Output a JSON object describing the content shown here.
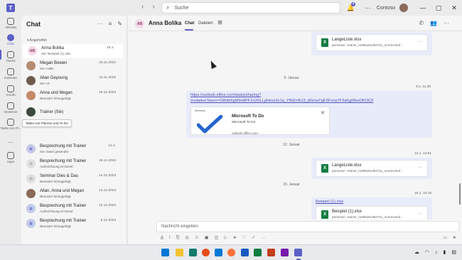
{
  "titlebar": {
    "search_placeholder": "Suche",
    "notification_count": "4",
    "org_name": "Contoso",
    "window_controls": [
      "—",
      "▢",
      "✕"
    ]
  },
  "rail": {
    "items": [
      {
        "label": "Aktivität",
        "icon": "bell-icon"
      },
      {
        "label": "Chat",
        "icon": "chat-icon"
      },
      {
        "label": "Teams",
        "icon": "teams-icon"
      },
      {
        "label": "Kalender",
        "icon": "calendar-icon"
      },
      {
        "label": "Anrufe",
        "icon": "phone-icon"
      },
      {
        "label": "OneDrive",
        "icon": "cloud-icon"
      },
      {
        "label": "Tasks von Pl...",
        "icon": "tasks-icon"
      },
      {
        "label": "...",
        "icon": "more-icon"
      },
      {
        "label": "Apps",
        "icon": "apps-icon"
      }
    ]
  },
  "chatlist": {
    "title": "Chat",
    "pinned_label": "Angeheftet",
    "tooltip": "Tasks von Planner und To Do",
    "chats": [
      {
        "name": "Anna Bolika",
        "sub": "Sie: Beispiel (1).xlsx",
        "date": "15.1.",
        "initials": "AB",
        "color": "#f4d9e6",
        "fg": "#8a3a60",
        "italic": false
      },
      {
        "name": "Megan Bowen",
        "sub": "Sie: Hallo",
        "date": "15.11.2022",
        "initials": "",
        "color": "#b58b6f",
        "fg": "#fff",
        "italic": false
      },
      {
        "name": "Allan Deyoung",
        "sub": "Sie: Hi",
        "date": "15.11.2022",
        "initials": "",
        "color": "#6e5a4e",
        "fg": "#fff",
        "italic": false
      },
      {
        "name": "Anna und Megan",
        "sub": "Benutzer hinzugefügt.",
        "date": "18.12.2023",
        "initials": "",
        "color": "#c4896a",
        "fg": "#fff",
        "italic": true
      },
      {
        "name": "Trainer (Sie)",
        "sub": "",
        "date": "",
        "initials": "",
        "color": "#3d4a3d",
        "fg": "#fff",
        "italic": false
      },
      {
        "name": "Besprechung mit Trainer",
        "sub": "Sie: Datei gesendet",
        "date": "12.1.",
        "initials": "▦",
        "color": "#c5cae9",
        "fg": "#5b5fc7",
        "italic": false
      },
      {
        "name": "Besprechung mit Trainer",
        "sub": "Aufzeichnung ist bereit",
        "date": "18.12.2023",
        "initials": "◷",
        "color": "#e0e0e0",
        "fg": "#616161",
        "italic": true
      },
      {
        "name": "Seminar Dies & Das",
        "sub": "Benutzer hinzugefügt.",
        "date": "14.12.2023",
        "initials": "◷",
        "color": "#e0e0e0",
        "fg": "#616161",
        "italic": true
      },
      {
        "name": "Allan, Anna und Megan",
        "sub": "Benutzer hinzugefügt.",
        "date": "14.12.2023",
        "initials": "",
        "color": "#8a6a5a",
        "fg": "#fff",
        "italic": true
      },
      {
        "name": "Besprechung mit Trainer",
        "sub": "Aufzeichnung ist bereit",
        "date": "12.12.2023",
        "initials": "▦",
        "color": "#c5cae9",
        "fg": "#5b5fc7",
        "italic": true
      },
      {
        "name": "Besprechung mit Trainer",
        "sub": "Benutzer hinzugefügt.",
        "date": "6.12.2023",
        "initials": "▦",
        "color": "#c5cae9",
        "fg": "#5b5fc7",
        "italic": true
      },
      {
        "name": "Besprechung mit Trainer",
        "sub": "Benutzer hinzugefügt.",
        "date": "6.12.2023",
        "initials": "▦",
        "color": "#c5cae9",
        "fg": "#5b5fc7",
        "italic": true
      },
      {
        "name": "Besprechung mit Trainer",
        "sub": "Benutzer hinzugefügt.",
        "date": "6.12.2023",
        "initials": "▦",
        "color": "#c5cae9",
        "fg": "#5b5fc7",
        "italic": true
      }
    ]
  },
  "main": {
    "contact_initials": "AB",
    "contact_name": "Anna Bolika",
    "tabs": [
      "Chat",
      "Dateien"
    ],
    "file1": {
      "name": "LangeListe.xlsx",
      "path": "personal › trainer_m365x61384711_onmicrosof..."
    },
    "date1": "9. Januar",
    "ts1": "9.1. 11:39",
    "link_line1": "https://outlook.office.com/tasks/sharing?",
    "link_line2": "InvitationToken=OWdh5gM9vBPFZn3SLLpHexx3x1a_YlNZnNU3_dGmaYgESFevp7F3aKgt9kwOKOC0",
    "preview": {
      "label": "Microsoft",
      "title": "Microsoft To Do",
      "desc": "Microsoft To Do",
      "url": "outlook.office.com"
    },
    "date2": "12. Januar",
    "ts2": "12.1. 14:51",
    "file2": {
      "name": "LangeListe.xlsx",
      "path": "personal › trainer_m365x61384711_onmicrosof..."
    },
    "date3": "15. Januar",
    "ts3": "15.1. 10:15",
    "link2": "Beispiel (1).xlsx",
    "file3": {
      "name": "Beispiel (1).xlsx",
      "path": "personal › trainer_m365x61384711_onmicrosof..."
    },
    "compose_placeholder": "Nachricht eingeben"
  },
  "colors": {
    "accent": "#5b5fc7",
    "bubble": "#e8ebfa",
    "excel": "#107c41"
  }
}
